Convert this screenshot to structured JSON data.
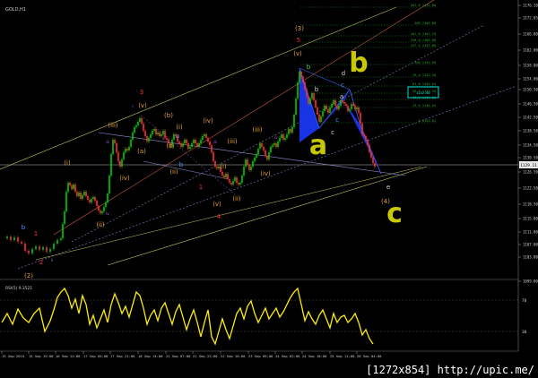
{
  "window": {
    "title": "GOLD,H1"
  },
  "price_axis": {
    "labels": [
      "1176.10",
      "1172.05",
      "1166.00",
      "1162.00",
      "1158.00",
      "1154.00",
      "1150.50",
      "1146.50",
      "1142.50",
      "1138.50",
      "1134.50",
      "1130.50",
      "1126.50",
      "1122.50",
      "1118.50",
      "1115.00",
      "1111.00",
      "1107.00",
      "1103.00",
      "1099.00"
    ],
    "current_price": "1129.11",
    "highlight_label": "1152.00"
  },
  "fib_levels": {
    "labels": [
      "261.8 1172.80",
      "200 1166.00",
      "161.8 1161.78",
      "150.0 1160.00",
      "127.2 1157.88",
      "100 1154.99",
      "76.4 1152.30",
      "61.8 1150.64",
      "50.0 1149.39",
      "38.2 1148.00",
      "23.6 1146.42",
      "0 1143.81"
    ]
  },
  "time_axis": {
    "labels": [
      "15 Sep 2015",
      "15 Sep 19:00",
      "16 Sep 12:00",
      "17 Sep 05:00",
      "17 Sep 21:00",
      "18 Sep 14:00",
      "21 Sep 07:00",
      "21 Sep 23:00",
      "22 Sep 16:00",
      "23 Sep 09:00",
      "24 Sep 02:00",
      "24 Sep 18:00",
      "25 Sep 11:00",
      "28 Sep 04:00"
    ]
  },
  "indicator": {
    "title": "RSI(5) 9.3521",
    "levels": [
      "70",
      "30"
    ]
  },
  "wave_labels": {
    "orange": [
      "(3)",
      "(4)",
      "(2)",
      "(i)",
      "(ii)",
      "(iii)",
      "(iv)",
      "(v)",
      "(a)",
      "(b)",
      "(c)",
      "(i)",
      "(ii)",
      "(iii)",
      "(iv)",
      "(v)",
      "(i)",
      "(ii)",
      "(iii)",
      "(iv)",
      "(v)"
    ],
    "red": [
      "3",
      "5",
      "4",
      "1",
      "2",
      "1"
    ],
    "blue": [
      "b",
      "c",
      "a",
      "b",
      "c"
    ],
    "white": [
      "a",
      "b",
      "c",
      "d",
      "e"
    ],
    "green": [
      "b"
    ],
    "olive": [
      "b",
      "a",
      "c"
    ],
    "purple": [
      "i",
      "ii",
      "iii",
      "iv",
      "v",
      "i",
      "ii",
      "iii",
      "iv"
    ]
  },
  "colors": {
    "background": "#000000",
    "bull_candle": "#00cc00",
    "bear_candle": "#ff3030",
    "rsi_line": "#ffee00",
    "pattern_fill": "#1a3bff",
    "highlight_box": "#00e0e0",
    "olive_label": "#c8c800"
  },
  "watermark": "[1272x854] http://upic.me/"
}
